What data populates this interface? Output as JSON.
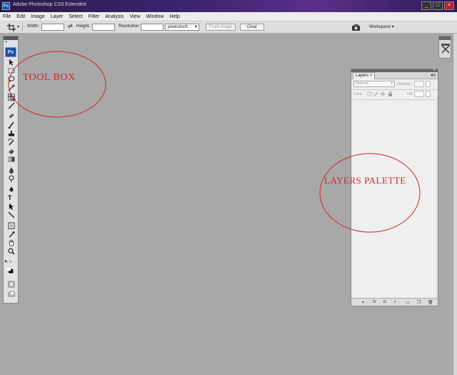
{
  "window": {
    "app_badge": "Ps",
    "title": "Adobe Photoshop CS3 Extended",
    "controls": [
      "_",
      "□",
      "×"
    ]
  },
  "menu": [
    "File",
    "Edit",
    "Image",
    "Layer",
    "Select",
    "Filter",
    "Analysis",
    "View",
    "Window",
    "Help"
  ],
  "options_bar": {
    "width_label": "Width:",
    "height_label": "Height:",
    "resolution_label": "Resolution:",
    "units_value": "pixels/inch",
    "front_image_label": "Front Image",
    "clear_label": "Clear",
    "workspace_label": "Workspace ▾",
    "dropdown_arrow": "▾",
    "swap_symbol": "⇄"
  },
  "toolbox": {
    "logo": "Ps",
    "collapse": "»",
    "tools": [
      "move-tool",
      "marquee-tool",
      "lasso-tool",
      "magic-wand-tool",
      "crop-tool",
      "slice-tool",
      "healing-brush-tool",
      "brush-tool",
      "clone-stamp-tool",
      "history-brush-tool",
      "eraser-tool",
      "gradient-tool",
      "blur-tool",
      "dodge-tool",
      "pen-tool",
      "type-tool",
      "path-selection-tool",
      "line-shape-tool",
      "notes-tool",
      "eyedropper-tool",
      "hand-tool",
      "zoom-tool",
      "default-colors",
      "color-swatches",
      "quick-mask",
      "screen-mode"
    ]
  },
  "layers_palette": {
    "tab_label": "Layers ×",
    "menu_icon": "▾≡",
    "blend_mode": "Normal",
    "opacity_label": "Opacity:",
    "lock_label": "Lock:",
    "fill_label": "Fill:",
    "collapse": "«",
    "footer_icons": [
      "link-icon",
      "fx-icon",
      "mask-icon",
      "adjustment-icon",
      "group-icon",
      "new-layer-icon",
      "trash-icon"
    ]
  },
  "annotations": {
    "toolbox_label": "TOOL BOX",
    "layers_label": "LAYERS PALETTE",
    "color": "#d4222a"
  }
}
